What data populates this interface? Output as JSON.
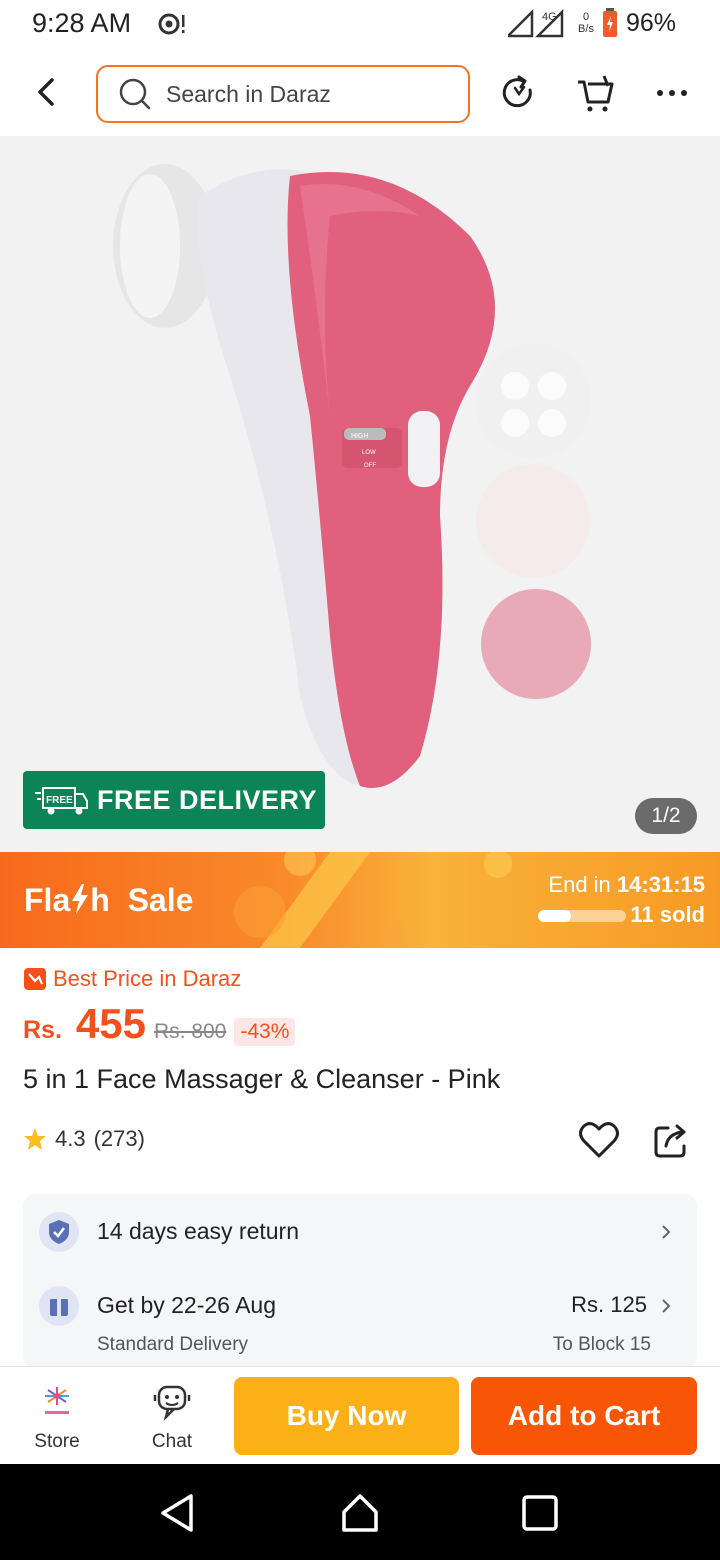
{
  "status_bar": {
    "time": "9:28 AM",
    "network": "4G",
    "data_rate_value": "0",
    "data_rate_unit": "B/s",
    "battery": "96%"
  },
  "search": {
    "placeholder": "Search in Daraz"
  },
  "gallery": {
    "switch_labels": [
      "HIGH",
      "LOW",
      "OFF"
    ],
    "free_delivery_tag": "FREE",
    "free_delivery": "FREE DELIVERY",
    "page_indicator": "1/2"
  },
  "flash_sale": {
    "title_part1": "Fla",
    "title_part2": "h",
    "title_part3": "Sale",
    "end_label": "End in",
    "countdown": "14:31:15",
    "sold": "11 sold",
    "progress": 0.38
  },
  "price": {
    "best_price_label": "Best Price in Daraz",
    "currency": "Rs.",
    "current": "455",
    "original": "Rs. 800",
    "discount": "-43%"
  },
  "product": {
    "title": "5 in 1 Face Massager & Cleanser - Pink",
    "rating": "4.3",
    "reviews": "(273)"
  },
  "services": {
    "return_text": "14 days easy return",
    "delivery_text": "Get by 22-26 Aug",
    "delivery_type": "Standard Delivery",
    "delivery_price": "Rs. 125",
    "delivery_location": "To Block 15"
  },
  "actions": {
    "store": "Store",
    "chat": "Chat",
    "buy_now": "Buy Now",
    "add_to_cart": "Add to Cart"
  },
  "colors": {
    "accent": "#f85606",
    "buy_now": "#fcb017",
    "free_delivery": "#0b8457",
    "product_pink": "#e0607e"
  }
}
